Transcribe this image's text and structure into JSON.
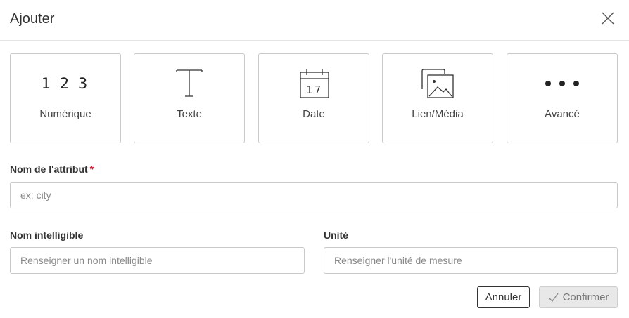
{
  "dialog": {
    "title": "Ajouter"
  },
  "types": [
    {
      "label": "Numérique",
      "icon": "numeric-123-icon",
      "glyph": "1 2 3"
    },
    {
      "label": "Texte",
      "icon": "text-t-icon"
    },
    {
      "label": "Date",
      "icon": "calendar-icon",
      "glyph": "17"
    },
    {
      "label": "Lien/Média",
      "icon": "image-gallery-icon"
    },
    {
      "label": "Avancé",
      "icon": "more-dots-icon"
    }
  ],
  "form": {
    "attribute_name": {
      "label": "Nom de l'attribut",
      "required_mark": "*",
      "placeholder": "ex: city",
      "value": ""
    },
    "display_name": {
      "label": "Nom intelligible",
      "placeholder": "Renseigner un nom intelligible",
      "value": ""
    },
    "unit": {
      "label": "Unité",
      "placeholder": "Renseigner l'unité de mesure",
      "value": ""
    }
  },
  "actions": {
    "cancel_label": "Annuler",
    "confirm_label": "Confirmer"
  }
}
